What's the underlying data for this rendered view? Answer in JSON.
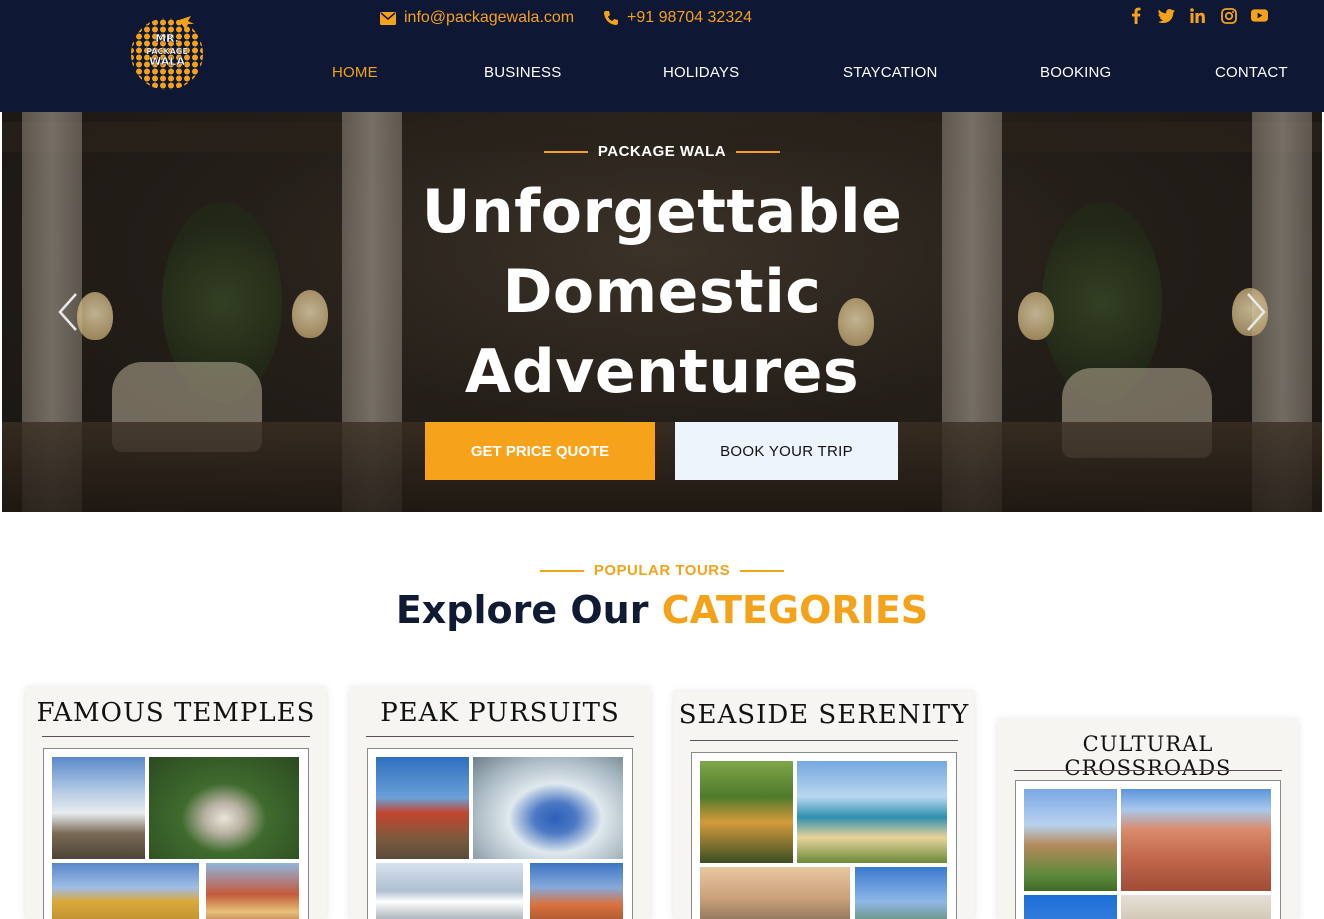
{
  "header": {
    "logo_text": [
      "MR.",
      "PACKAGE",
      "WALA"
    ],
    "email": "info@packagewala.com",
    "phone": "+91 98704 32324",
    "social": [
      "facebook-icon",
      "twitter-icon",
      "linkedin-icon",
      "instagram-icon",
      "youtube-icon"
    ],
    "nav": [
      "HOME",
      "BUSINESS",
      "HOLIDAYS",
      "STAYCATION",
      "BOOKING",
      "CONTACT"
    ],
    "active_nav": "HOME"
  },
  "hero": {
    "kicker": "PACKAGE WALA",
    "title_lines": [
      "Unforgettable",
      "Domestic",
      "Adventures"
    ],
    "primary_button": "GET PRICE QUOTE",
    "secondary_button": "BOOK YOUR TRIP"
  },
  "section": {
    "kicker": "POPULAR TOURS",
    "title_main": "Explore Our",
    "title_accent": "CATEGORIES"
  },
  "categories": [
    {
      "title": "FAMOUS TEMPLES"
    },
    {
      "title": "PEAK PURSUITS"
    },
    {
      "title": "SEASIDE SERENITY"
    },
    {
      "title": "CULTURAL CROSSROADS"
    }
  ],
  "colors": {
    "navy": "#0e1733",
    "accent": "#f5a21b",
    "button_light": "#eef4fb"
  }
}
